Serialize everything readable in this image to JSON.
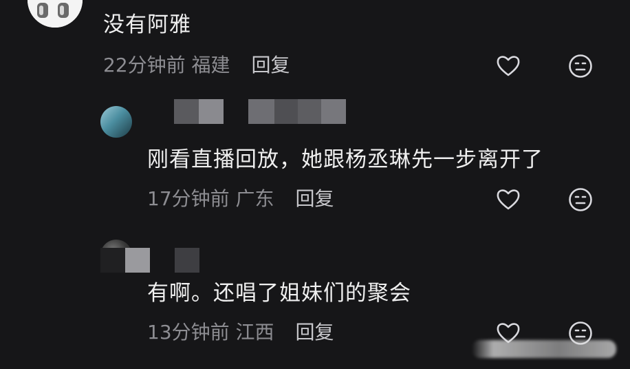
{
  "comments": [
    {
      "text": "没有阿雅",
      "time": "22分钟前",
      "location": "福建",
      "reply_label": "回复",
      "like_icon": "heart-outline-icon",
      "emoji_icon": "neutral-face-icon"
    },
    {
      "text": "刚看直播回放，她跟杨丞琳先一步离开了",
      "time": "17分钟前",
      "location": "广东",
      "reply_label": "回复",
      "like_icon": "heart-outline-icon",
      "emoji_icon": "neutral-face-icon"
    },
    {
      "text": "有啊。还唱了姐妹们的聚会",
      "time": "13分钟前",
      "location": "江西",
      "reply_label": "回复",
      "like_icon": "heart-outline-icon",
      "emoji_icon": "neutral-face-icon"
    }
  ],
  "colors": {
    "background": "#161618",
    "text": "#efefef",
    "meta": "#8d8d92",
    "icon": "#d9d9de"
  }
}
